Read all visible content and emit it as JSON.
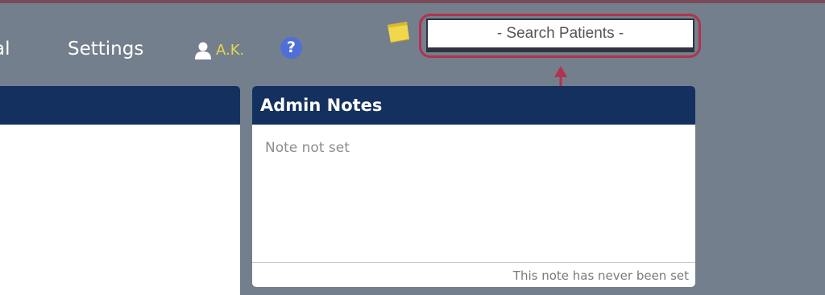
{
  "nav": {
    "partial_label": "al",
    "settings_label": "Settings"
  },
  "user": {
    "name": "A.K."
  },
  "help": {
    "label": "?"
  },
  "search": {
    "placeholder": "- Search Patients -"
  },
  "admin_notes": {
    "title": "Admin Notes",
    "note": "Note not set",
    "status": "This note has never been set"
  },
  "colors": {
    "background": "#747f8d",
    "panel_header": "#14305e",
    "user_name": "#e6d84a",
    "help_icon": "#4f6fd8",
    "annotation": "#b3324f"
  },
  "icons": {
    "user": "user-icon",
    "help": "help-icon",
    "sticky_note": "sticky-note-icon",
    "annotation_arrow": "arrow-up-icon"
  }
}
